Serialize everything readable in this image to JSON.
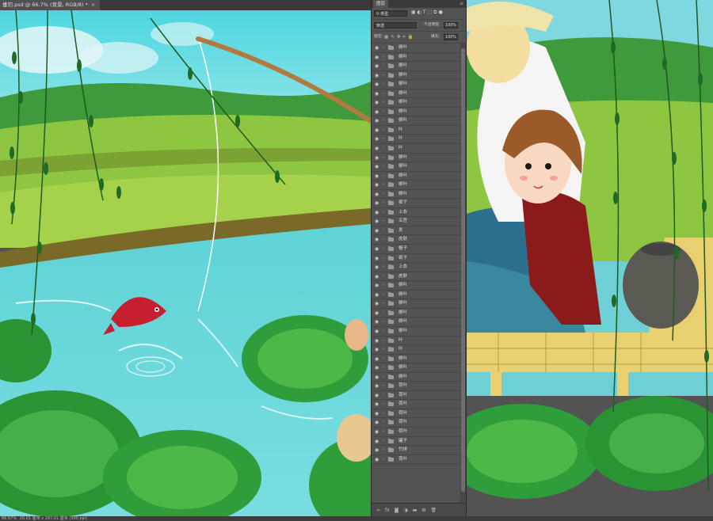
{
  "document": {
    "tab_title": "垂钓.psd @ 66.7% (背景, RGB/8) *",
    "tab_close": "×"
  },
  "status": {
    "zoom": "66.67%",
    "doc_size": "20.01 厘米 x 297.01 厘米 (300 ppi)"
  },
  "layers_panel": {
    "tab_label": "图层",
    "menu_icon": "menu-icon",
    "filter_type": "类型",
    "blend_mode": "穿透",
    "opacity_label": "不透明度:",
    "opacity_value": "100%",
    "lock_label": "锁定:",
    "fill_label": "填充:",
    "fill_value": "100%",
    "layers": [
      "柳叶",
      "柳叶",
      "柳叶",
      "柳叶",
      "柳叶",
      "柳叶",
      "柳叶",
      "柳叶",
      "柳叶",
      "叶",
      "叶",
      "叶",
      "柳叶",
      "柳叶",
      "柳叶",
      "柳叶",
      "柳叶",
      "裤子",
      "上衣",
      "五官",
      "发",
      "皮肤",
      "帽子",
      "裤子",
      "上衣",
      "皮肤",
      "柳叶",
      "柳叶",
      "柳叶",
      "柳叶",
      "柳叶",
      "柳叶",
      "叶",
      "叶",
      "柳叶",
      "柳叶",
      "柳叶",
      "荷叶",
      "荷叶",
      "荷叶",
      "荷叶",
      "荷叶",
      "荷叶",
      "罐子",
      "竹排",
      "荷叶"
    ]
  },
  "colors": {
    "panel_bg": "#535353",
    "water": "#5fd3d6",
    "grass": "#8ec641",
    "lotus": "#2f9e3a",
    "shirt_red": "#8b1a1a"
  }
}
